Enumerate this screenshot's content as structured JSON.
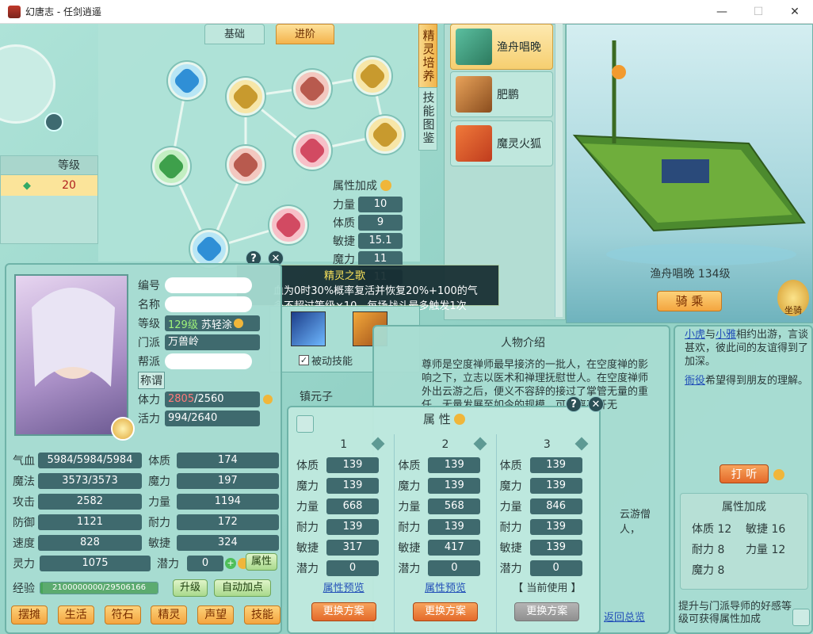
{
  "window": {
    "title": "幻唐志 - 任剑逍遥",
    "min": "—",
    "max": "☐",
    "close": "✕"
  },
  "top_tabs": {
    "basic": "基础",
    "advanced": "进阶"
  },
  "side_tabs": {
    "spirit": "精灵培养",
    "skill_book": "技能图鉴"
  },
  "level_header": {
    "col": "等级",
    "value": "20"
  },
  "attr_bonus": {
    "title": "属性加成",
    "rows": [
      {
        "label": "力量",
        "value": "10"
      },
      {
        "label": "体质",
        "value": "9"
      },
      {
        "label": "敏捷",
        "value": "15.1"
      },
      {
        "label": "魔力",
        "value": "11"
      },
      {
        "label": "",
        "value": "11"
      }
    ]
  },
  "tooltip": {
    "title": "精灵之歌",
    "line1": "血为0时30%概率复活并恢复20%+100的气",
    "line2": "多不超过等级×10，每场战斗最多触发1次",
    "passive": "被动技能"
  },
  "pets": [
    {
      "name": "渔舟唱晚"
    },
    {
      "name": "肥鹏"
    },
    {
      "name": "魔灵火狐"
    }
  ],
  "mount": {
    "name_level": "渔舟唱晚 134级",
    "ride": "骑 乘",
    "mount_label": "坐骑"
  },
  "char": {
    "labels": {
      "id": "编号",
      "name": "名称",
      "level": "等级",
      "sect": "门派",
      "guild": "帮派",
      "title": "称谓",
      "stamina": "体力",
      "vitality": "活力"
    },
    "level": "129级",
    "partner": "苏轻涂",
    "sect": "万兽岭",
    "stamina_cur": "2805",
    "stamina_max": "/2560",
    "vitality": "994/2640"
  },
  "stats": [
    {
      "l1": "气血",
      "v1": "5984/5984/5984",
      "l2": "体质",
      "v2": "174"
    },
    {
      "l1": "魔法",
      "v1": "3573/3573",
      "l2": "魔力",
      "v2": "197"
    },
    {
      "l1": "攻击",
      "v1": "2582",
      "l2": "力量",
      "v2": "1194"
    },
    {
      "l1": "防御",
      "v1": "1121",
      "l2": "耐力",
      "v2": "172"
    },
    {
      "l1": "速度",
      "v1": "828",
      "l2": "敏捷",
      "v2": "324"
    },
    {
      "l1": "灵力",
      "v1": "1075",
      "l2": "潜力",
      "v2": "0"
    }
  ],
  "attr_btn": "属性",
  "exp": {
    "label": "经验",
    "value": "2100000000/29506166",
    "progress": 0.02,
    "upgrade": "升级",
    "auto": "自动加点"
  },
  "bottom_btns": [
    "摆摊",
    "生活",
    "符石",
    "精灵",
    "声望",
    "技能"
  ],
  "zhenyuanzi": "镇元子",
  "npc": {
    "title": "人物介绍",
    "desc": "尊师是空度禅师最早接济的一批人，在空度禅的影响之下，立志以医术和禅理抚慰世人。在空度禅师外出云游之后，便义不容辞的接过了掌管无量的重任，无量发展至如今的规模，可谓离不开无",
    "desc2": "云游僧人，",
    "rel_a": "小虎",
    "rel_and": "与",
    "rel_b": "小雅",
    "rel_text": "相约出游，言谈甚欢，彼此间的友谊得到了加深。",
    "rel2_a": "衙役",
    "rel2_text": "希望得到朋友的理解。",
    "ask": "打 听",
    "bonus_title": "属性加成",
    "bonus": [
      {
        "l": "体质",
        "v": "12"
      },
      {
        "l": "敏捷",
        "v": "16"
      },
      {
        "l": "耐力",
        "v": "8"
      },
      {
        "l": "力量",
        "v": "12"
      },
      {
        "l": "魔力",
        "v": "8"
      }
    ],
    "footer": "提升与门派导师的好感等级可获得属性加成",
    "back": "返回总览"
  },
  "scheme": {
    "title": "属 性",
    "cols": [
      {
        "num": "1",
        "rows": [
          {
            "l": "体质",
            "v": "139"
          },
          {
            "l": "魔力",
            "v": "139"
          },
          {
            "l": "力量",
            "v": "668"
          },
          {
            "l": "耐力",
            "v": "139"
          },
          {
            "l": "敏捷",
            "v": "317"
          },
          {
            "l": "潜力",
            "v": "0"
          }
        ],
        "preview": "属性预览",
        "btn": "更换方案"
      },
      {
        "num": "2",
        "rows": [
          {
            "l": "体质",
            "v": "139"
          },
          {
            "l": "魔力",
            "v": "139"
          },
          {
            "l": "力量",
            "v": "568"
          },
          {
            "l": "耐力",
            "v": "139"
          },
          {
            "l": "敏捷",
            "v": "417"
          },
          {
            "l": "潜力",
            "v": "0"
          }
        ],
        "preview": "属性预览",
        "btn": "更换方案"
      },
      {
        "num": "3",
        "rows": [
          {
            "l": "体质",
            "v": "139"
          },
          {
            "l": "魔力",
            "v": "139"
          },
          {
            "l": "力量",
            "v": "846"
          },
          {
            "l": "耐力",
            "v": "139"
          },
          {
            "l": "敏捷",
            "v": "139"
          },
          {
            "l": "潜力",
            "v": "0"
          }
        ],
        "preview": "【 当前使用 】",
        "btn": "更换方案"
      }
    ]
  },
  "colors": {
    "orange": "#f4a53f",
    "teal": "#3f6a6e",
    "red_value": "#c0282d"
  }
}
